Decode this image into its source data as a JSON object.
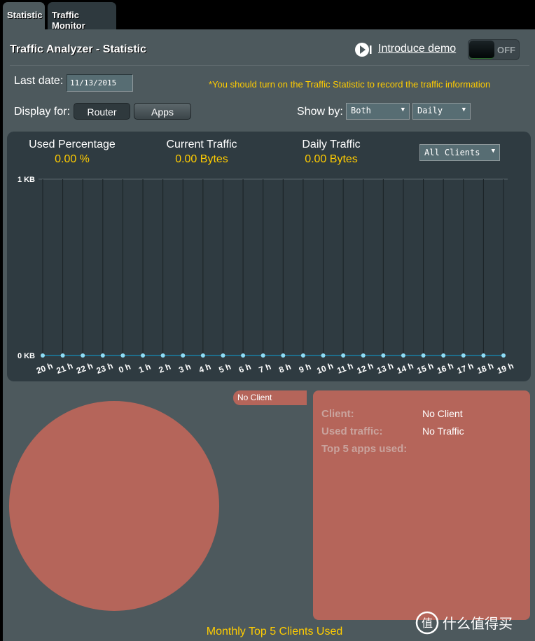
{
  "tabs": [
    {
      "label": "Statistic",
      "active": true
    },
    {
      "label": "Traffic Monitor",
      "active": false
    }
  ],
  "header": {
    "title": "Traffic Analyzer - Statistic",
    "demo_icon": "play-camera-icon",
    "demo_link": "Introduce demo",
    "toggle_label": "OFF",
    "toggle_state": "off"
  },
  "filters": {
    "last_date_label": "Last date:",
    "last_date_value": "11/13/2015",
    "warning": "*You should turn on the Traffic Statistic to record the traffic information",
    "display_for_label": "Display for:",
    "display_for_options": [
      "Router",
      "Apps"
    ],
    "display_for_selected": "Router",
    "show_by_label": "Show by:",
    "show_by_direction": "Both",
    "show_by_period": "Daily"
  },
  "stats": {
    "used_percentage_label": "Used Percentage",
    "used_percentage_value": "0.00 %",
    "current_traffic_label": "Current Traffic",
    "current_traffic_value": "0.00 Bytes",
    "daily_traffic_label": "Daily Traffic",
    "daily_traffic_value": "0.00 Bytes",
    "client_select": "All Clients"
  },
  "chart_data": {
    "type": "line",
    "categories": [
      "20 h",
      "21 h",
      "22 h",
      "23 h",
      "0 h",
      "1 h",
      "2 h",
      "3 h",
      "4 h",
      "5 h",
      "6 h",
      "7 h",
      "8 h",
      "9 h",
      "10 h",
      "11 h",
      "12 h",
      "13 h",
      "14 h",
      "15 h",
      "16 h",
      "17 h",
      "18 h",
      "19 h"
    ],
    "values": [
      0,
      0,
      0,
      0,
      0,
      0,
      0,
      0,
      0,
      0,
      0,
      0,
      0,
      0,
      0,
      0,
      0,
      0,
      0,
      0,
      0,
      0,
      0,
      0
    ],
    "yticks": [
      "0 KB",
      "1 KB"
    ],
    "ylim": [
      0,
      1
    ],
    "yunit": "KB",
    "grid": true,
    "line_color": "#1e6e8c",
    "point_color": "#8fdcf5"
  },
  "pie": {
    "legend": "No Client",
    "color": "#b5655a"
  },
  "client_info": {
    "client_label": "Client:",
    "client_value": "No Client",
    "used_traffic_label": "Used traffic:",
    "used_traffic_value": "No Traffic",
    "top_apps_label": "Top 5 apps used:"
  },
  "footer": "Monthly Top 5 Clients Used",
  "watermark": "值 什么值得买"
}
